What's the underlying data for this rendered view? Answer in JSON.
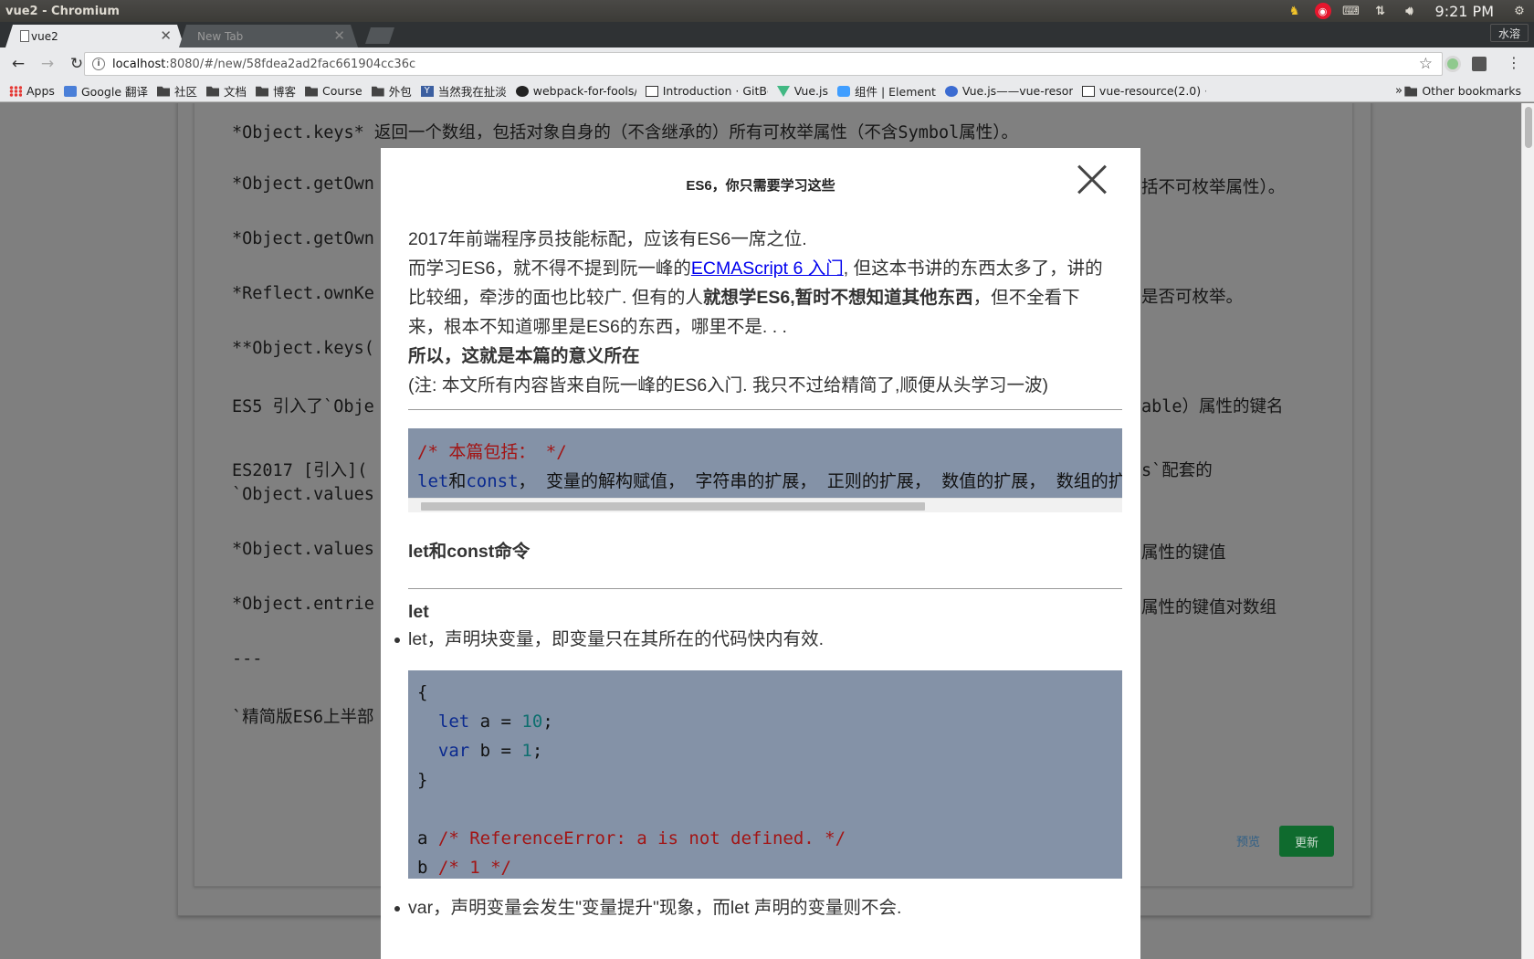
{
  "os": {
    "window_title": "vue2 - Chromium",
    "clock": "9:21 PM",
    "user_button": "水溶"
  },
  "browser": {
    "tabs": [
      {
        "title": "vue2",
        "active": true
      },
      {
        "title": "New Tab",
        "active": false
      }
    ],
    "url_host": "localhost",
    "url_rest": ":8080/#/new/58fdea2ad2fac661904cc36c",
    "bookmarks": [
      {
        "label": "Apps",
        "icon": "apps-grid-icon"
      },
      {
        "label": "Google 翻译",
        "icon": "google-translate-icon"
      },
      {
        "label": "社区",
        "icon": "folder-icon"
      },
      {
        "label": "文档",
        "icon": "folder-icon"
      },
      {
        "label": "博客",
        "icon": "folder-icon"
      },
      {
        "label": "Course",
        "icon": "folder-icon"
      },
      {
        "label": "外包",
        "icon": "folder-icon"
      },
      {
        "label": "当然我在扯淡",
        "icon": "yinxiang-icon"
      },
      {
        "label": "webpack-for-fools/",
        "icon": "github-icon"
      },
      {
        "label": "Introduction · GitBo",
        "icon": "gitbook-icon"
      },
      {
        "label": "Vue.js",
        "icon": "vue-icon"
      },
      {
        "label": "组件 | Element",
        "icon": "element-icon"
      },
      {
        "label": "Vue.js——vue-resor",
        "icon": "vue-resource-icon"
      },
      {
        "label": "vue-resource(2.0) ·",
        "icon": "gitbook-icon"
      }
    ],
    "bookmarks_more": "»",
    "other_bookmarks": "Other bookmarks"
  },
  "background_editor": {
    "lines": [
      "*Object.keys*  返回一个数组，包括对象自身的（不含继承的）所有可枚举属性（不含Symbol属性）。",
      "*Object.getOwn",
      "*Object.getOwn",
      "*Reflect.ownKe",
      "**Object.keys(",
      "ES5 引入了`Obje",
      "ES2017 [引入](",
      "`Object.values",
      "*Object.values",
      "*Object.entrie",
      "---",
      "`精简版ES6上半部"
    ],
    "right_fragments": [
      "括不可枚举属性）。",
      "是否可枚举。",
      "able）属性的键名",
      "s`配套的",
      "属性的键值",
      "属性的键值对数组"
    ],
    "preview_label": "预览",
    "update_label": "更新"
  },
  "modal": {
    "title": "ES6，你只需要学习这些",
    "intro_line1": "2017年前端程序员技能标配，应该有ES6一席之位.",
    "intro_line2_before": "而学习ES6，就不得不提到阮一峰的",
    "intro_link": "ECMAScript 6 入门",
    "intro_line2_after": ", 但这本书讲的东西太多了，讲的",
    "intro_line3_before": "比较细，牵涉的面也比较广. 但有的人",
    "intro_line3_bold": "就想学ES6,暂时不想知道其他东西",
    "intro_line3_after": "，但不全看下",
    "intro_line4": "来，根本不知道哪里是ES6的东西，哪里不是. . .",
    "intro_line5": "所以，这就是本篇的意义所在",
    "intro_line6": "(注: 本文所有内容皆来自阮一峰的ES6入门. 我只不过给精简了,顺便从头学习一波)",
    "summary_comment": "/* 本篇包括： */",
    "summary_kw1": "let",
    "summary_and": "和",
    "summary_kw2": "const",
    "summary_rest": "， 变量的解构赋值， 字符串的扩展， 正则的扩展， 数值的扩展， 数组的扩展",
    "h_let_const": "let和const命令",
    "h_let": "let",
    "let_bullet": "let，声明块变量，即变量只在其所在的代码快内有效.",
    "code": {
      "open": "{",
      "kw_let": "let",
      "let_rest": " a = ",
      "num_10": "10",
      "kw_var": "var",
      "var_rest": " b = ",
      "num_1": "1",
      "semi": ";",
      "close": "}",
      "line_a": "a ",
      "comment_a": "/* ReferenceError: a is not defined. */",
      "line_b": "b ",
      "comment_b": "/* 1 */"
    },
    "var_bullet": "var，声明变量会发生\"变量提升\"现象，而let 声明的变量则不会."
  }
}
